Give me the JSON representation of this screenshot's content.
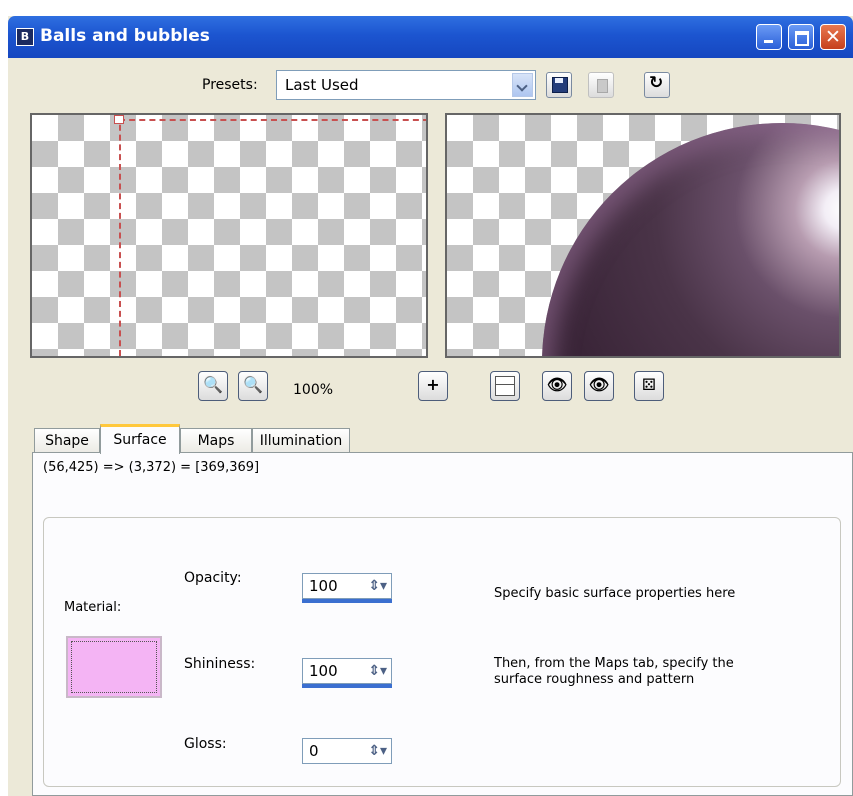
{
  "window": {
    "title": "Balls and bubbles",
    "app_icon": "B"
  },
  "colors": {
    "title_bar": "#1c55d0",
    "accent_tab": "#ffc83c",
    "material_swatch": "#f4b4f4",
    "guide_line": "#c85050"
  },
  "presets": {
    "label": "Presets:",
    "value": "Last Used"
  },
  "toolbar": {
    "zoom_out_glyph": "🔍-",
    "zoom_in_glyph": "🔍+",
    "zoom_level": "100%",
    "move_glyph": "+"
  },
  "tabs": [
    {
      "label": "Shape"
    },
    {
      "label": "Surface"
    },
    {
      "label": "Maps"
    },
    {
      "label": "Illumination"
    }
  ],
  "surface": {
    "coords": "(56,425) => (3,372) = [369,369]",
    "material_label": "Material:",
    "opacity_label": "Opacity:",
    "opacity_value": "100",
    "shininess_label": "Shininess:",
    "shininess_value": "100",
    "gloss_label": "Gloss:",
    "gloss_value": "0",
    "desc1": "Specify basic surface properties here",
    "desc2_line1": "Then, from the Maps tab, specify the",
    "desc2_line2": "surface roughness and pattern"
  }
}
